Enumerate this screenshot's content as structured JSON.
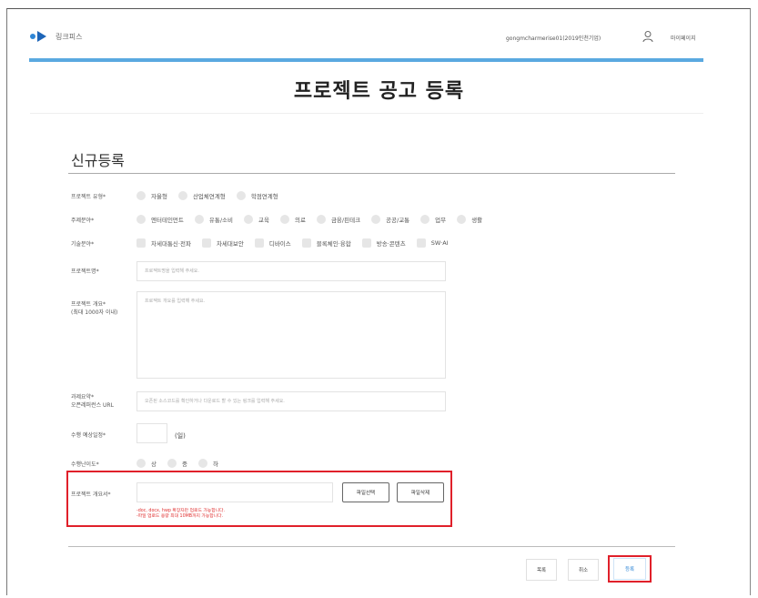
{
  "header": {
    "logo_text": "링크피스",
    "user_info": "gongmcharmerise01(2019인천기업)",
    "mypage_label": "마이페이지"
  },
  "page_title": "프로젝트 공고 등록",
  "section_title": "신규등록",
  "form": {
    "project_type": {
      "label": "프로젝트 유형*",
      "options": [
        "자율형",
        "산업체연계형",
        "학점연계형"
      ]
    },
    "theme": {
      "label": "주제분야*",
      "options": [
        "엔터테인먼트",
        "유통/소비",
        "교육",
        "의료",
        "금융/핀테크",
        "공공/교통",
        "업무",
        "생활"
      ]
    },
    "tech": {
      "label": "기술분야*",
      "options": [
        "차세대통신·전파",
        "차세대보안",
        "디바이스",
        "블록체인·융합",
        "방송·콘텐츠",
        "SW·AI"
      ]
    },
    "project_name": {
      "label": "프로젝트명*",
      "placeholder": "프로젝트명을 입력해 주세요."
    },
    "overview": {
      "label": "프로젝트 개요*",
      "sublabel": "(최대 1000자 이내)",
      "placeholder": "프로젝트 개요를 입력해 주세요."
    },
    "ref_url": {
      "label": "과제요약*",
      "sublabel": "오픈레퍼런스 URL",
      "placeholder": "오픈된 소스코드를 확인하거나 다운로드 할 수 있는 링크를 입력해 주세요."
    },
    "duration": {
      "label": "수행 예상일정*",
      "value": "",
      "unit": "(일)"
    },
    "difficulty": {
      "label": "수행난이도*",
      "options": [
        "상",
        "중",
        "하"
      ]
    },
    "attachment": {
      "label": "프로젝트 개요서*",
      "select_button": "파일선택",
      "delete_button": "파일삭제",
      "warning_line1": "-doc, docx, hwp 확장자만 업로드 가능합니다.",
      "warning_line2": "-파일 업로드 용량 최대 10MB까지 가능합니다."
    }
  },
  "footer": {
    "list_button": "목록",
    "cancel_button": "취소",
    "submit_button": "등록"
  }
}
